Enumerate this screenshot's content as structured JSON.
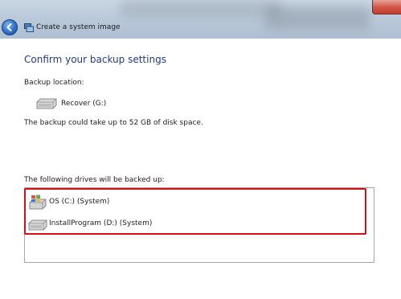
{
  "window": {
    "title": "Create a system image"
  },
  "content": {
    "heading": "Confirm your backup settings",
    "backup_location_label": "Backup location:",
    "backup_location_value": "Recover (G:)",
    "space_message": "The backup could take up to 52 GB of disk space.",
    "drives_label": "The following drives will be backed up:",
    "drives": [
      {
        "label": "OS (C:) (System)",
        "icon": "windows-drive-icon"
      },
      {
        "label": "InstallProgram (D:) (System)",
        "icon": "hard-drive-icon"
      }
    ]
  },
  "colors": {
    "heading": "#1e3a8c",
    "highlight_border": "#d3101a"
  }
}
